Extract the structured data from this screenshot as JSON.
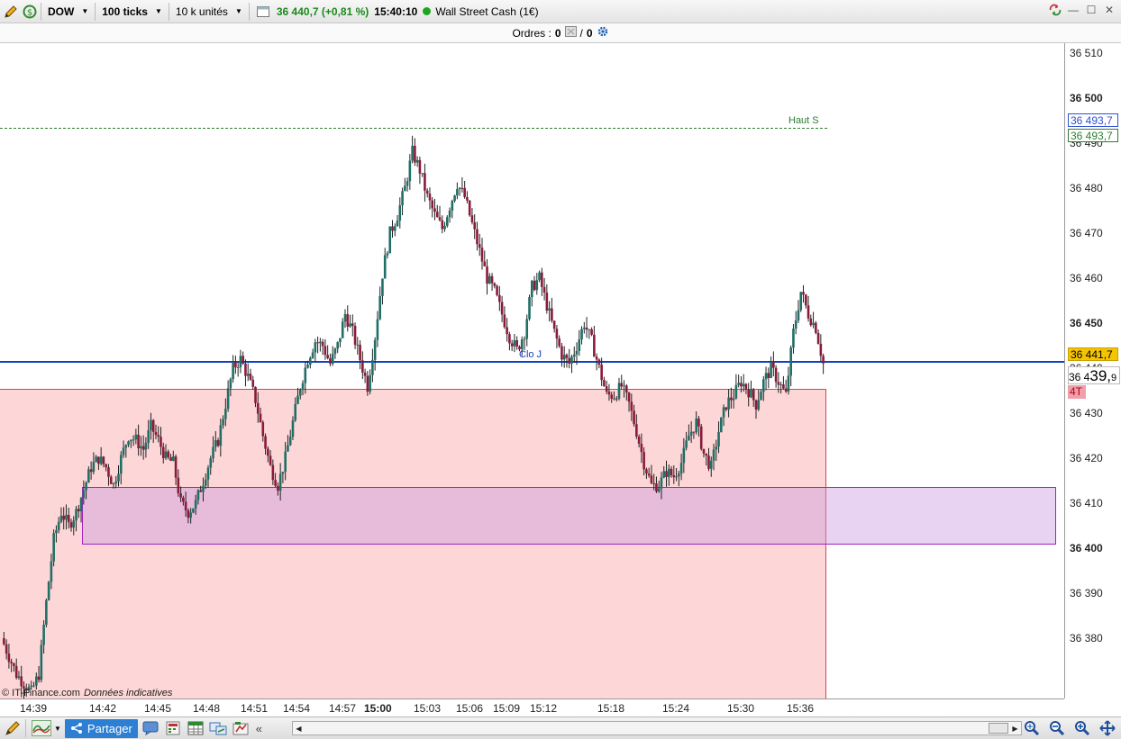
{
  "toolbar": {
    "instrument_code": "DOW",
    "interval": "100 ticks",
    "units": "10 k unités",
    "last_price": "36 440,7 (+0,81 %)",
    "time": "15:40:10",
    "instrument_name": "Wall Street Cash (1€)"
  },
  "orders": {
    "label": "Ordres :",
    "count_a": "0",
    "sep": "/",
    "count_b": "0"
  },
  "chart": {
    "haut_label": "Haut S",
    "clot_label": "Clo J",
    "copyright": "© IT-Finance.com",
    "disclaimer": "Données indicatives",
    "price_labels": [
      {
        "text": "36 510",
        "bold": false
      },
      {
        "text": "36 500",
        "bold": true
      },
      {
        "text": "36 490",
        "bold": false
      },
      {
        "text": "36 480",
        "bold": false
      },
      {
        "text": "36 470",
        "bold": false
      },
      {
        "text": "36 460",
        "bold": false
      },
      {
        "text": "36 450",
        "bold": true
      },
      {
        "text": "36 440",
        "bold": false
      },
      {
        "text": "36 430",
        "bold": false
      },
      {
        "text": "36 420",
        "bold": false
      },
      {
        "text": "36 410",
        "bold": false
      },
      {
        "text": "36 400",
        "bold": true
      },
      {
        "text": "36 390",
        "bold": false
      },
      {
        "text": "36 380",
        "bold": false
      }
    ],
    "axis_tags": {
      "haut_blue": "36 493,7",
      "haut_green": "36 493,7",
      "close_yellow": "36 441,7",
      "current_small": "36 4",
      "current_big": "39,",
      "current_sup": "9",
      "ticks_tag": "4T"
    },
    "time_labels": [
      {
        "text": "14:39",
        "bold": false
      },
      {
        "text": "14:42",
        "bold": false
      },
      {
        "text": "14:45",
        "bold": false
      },
      {
        "text": "14:48",
        "bold": false
      },
      {
        "text": "14:51",
        "bold": false
      },
      {
        "text": "14:54",
        "bold": false
      },
      {
        "text": "14:57",
        "bold": false
      },
      {
        "text": "15:00",
        "bold": true
      },
      {
        "text": "15:03",
        "bold": false
      },
      {
        "text": "15:06",
        "bold": false
      },
      {
        "text": "15:09",
        "bold": false
      },
      {
        "text": "15:12",
        "bold": false
      },
      {
        "text": "15:18",
        "bold": false
      },
      {
        "text": "15:24",
        "bold": false
      },
      {
        "text": "15:30",
        "bold": false
      },
      {
        "text": "15:36",
        "bold": false
      }
    ],
    "close_path": [
      36380,
      36376,
      36372,
      36370,
      36368,
      36372,
      36388,
      36402,
      36408,
      36405,
      36408,
      36413,
      36418,
      36420,
      36418,
      36414,
      36420,
      36425,
      36424,
      36422,
      36427,
      36424,
      36420,
      36419,
      36410,
      36408,
      36410,
      36415,
      36420,
      36424,
      36432,
      36440,
      36442,
      36438,
      36433,
      36425,
      36418,
      36414,
      36420,
      36428,
      36436,
      36442,
      36446,
      36445,
      36441,
      36445,
      36452,
      36448,
      36442,
      36436,
      36447,
      36461,
      36470,
      36474,
      36480,
      36488,
      36484,
      36478,
      36474,
      36471,
      36476,
      36481,
      36478,
      36472,
      36466,
      36460,
      36457,
      36452,
      36447,
      36444,
      36448,
      36458,
      36460,
      36454,
      36448,
      36443,
      36441,
      36445,
      36450,
      36446,
      36440,
      36434,
      36434,
      36436,
      36432,
      36426,
      36419,
      36414,
      36414,
      36417,
      36416,
      36419,
      36425,
      36428,
      36421,
      36418,
      36426,
      36432,
      36434,
      36437,
      36435,
      36432,
      36437,
      36440,
      36437,
      36434,
      36448,
      36457,
      36452,
      36449,
      36441
    ],
    "colors": {
      "up": "#1f6f66",
      "down": "#8b1a3a",
      "blue_line": "#1040c8",
      "red_zone_border": "#dd4444",
      "purple_zone_border": "#a020c0"
    }
  },
  "bottom": {
    "share_label": "Partager"
  }
}
